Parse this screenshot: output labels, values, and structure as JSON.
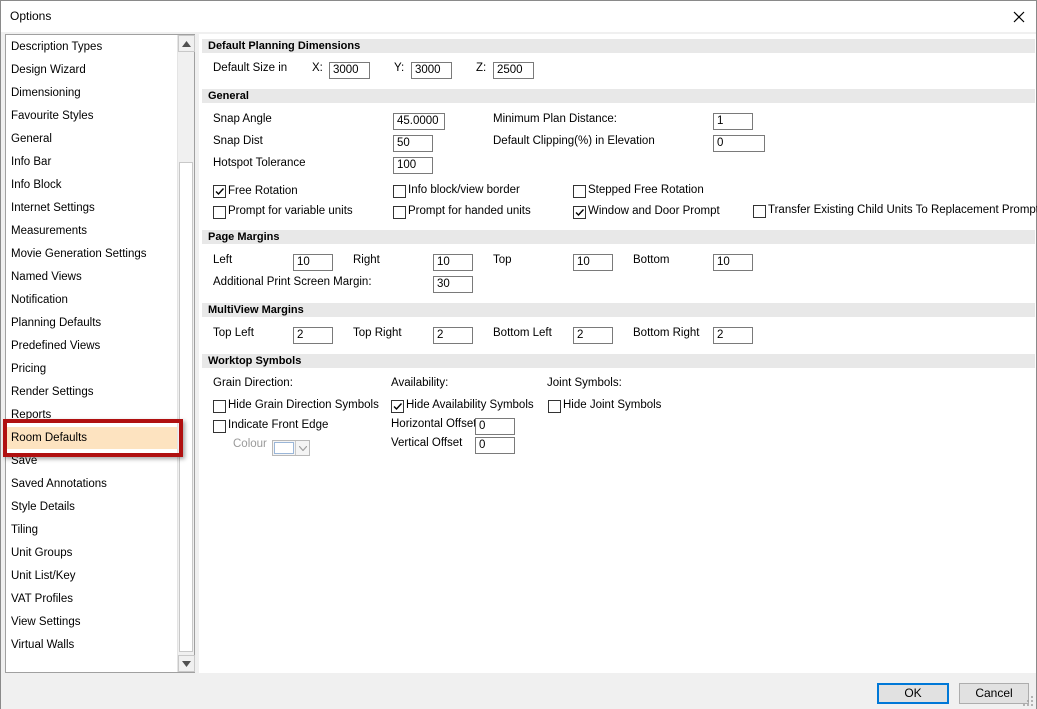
{
  "window": {
    "title": "Options",
    "close_icon": "close-icon"
  },
  "sidebar": {
    "items": [
      "Description Types",
      "Design Wizard",
      "Dimensioning",
      "Favourite Styles",
      "General",
      "Info Bar",
      "Info Block",
      "Internet Settings",
      "Measurements",
      "Movie Generation Settings",
      "Named Views",
      "Notification",
      "Planning Defaults",
      "Predefined Views",
      "Pricing",
      "Render Settings",
      "Reports",
      "Room Defaults",
      "Save",
      "Saved Annotations",
      "Style Details",
      "Tiling",
      "Unit Groups",
      "Unit List/Key",
      "VAT Profiles",
      "View Settings",
      "Virtual Walls"
    ],
    "selected": "Room Defaults",
    "highlight_color": "#b01010",
    "selected_color": "#fde3c0"
  },
  "planning_dimensions": {
    "header": "Default Planning Dimensions",
    "size_label": "Default Size in",
    "x_label": "X:",
    "x_value": "3000",
    "y_label": "Y:",
    "y_value": "3000",
    "z_label": "Z:",
    "z_value": "2500"
  },
  "general": {
    "header": "General",
    "snap_angle_label": "Snap Angle",
    "snap_angle_value": "45.0000",
    "snap_dist_label": "Snap Dist",
    "snap_dist_value": "50",
    "hotspot_label": "Hotspot Tolerance",
    "hotspot_value": "100",
    "min_plan_label": "Minimum Plan Distance:",
    "min_plan_value": "1",
    "clipping_label": "Default Clipping(%) in Elevation",
    "clipping_value": "0",
    "free_rotation": {
      "label": "Free Rotation",
      "checked": true
    },
    "info_block_border": {
      "label": "Info block/view border",
      "checked": false
    },
    "stepped_rotation": {
      "label": "Stepped Free Rotation",
      "checked": false
    },
    "prompt_variable": {
      "label": "Prompt for variable units",
      "checked": false
    },
    "prompt_handed": {
      "label": "Prompt for handed units",
      "checked": false
    },
    "window_door_prompt": {
      "label": "Window and Door Prompt",
      "checked": true
    },
    "transfer_child": {
      "label": "Transfer Existing Child Units To Replacement Prompt",
      "checked": false
    }
  },
  "page_margins": {
    "header": "Page Margins",
    "left_label": "Left",
    "left_value": "10",
    "right_label": "Right",
    "right_value": "10",
    "top_label": "Top",
    "top_value": "10",
    "bottom_label": "Bottom",
    "bottom_value": "10",
    "additional_label": "Additional Print Screen Margin:",
    "additional_value": "30"
  },
  "multiview_margins": {
    "header": "MultiView Margins",
    "top_left_label": "Top Left",
    "top_left_value": "2",
    "top_right_label": "Top Right",
    "top_right_value": "2",
    "bottom_left_label": "Bottom Left",
    "bottom_left_value": "2",
    "bottom_right_label": "Bottom Right",
    "bottom_right_value": "2"
  },
  "worktop_symbols": {
    "header": "Worktop Symbols",
    "grain_label": "Grain Direction:",
    "availability_label": "Availability:",
    "joint_label": "Joint Symbols:",
    "hide_grain": {
      "label": "Hide Grain Direction Symbols",
      "checked": false
    },
    "indicate_front": {
      "label": "Indicate Front Edge",
      "checked": false
    },
    "colour_label": "Colour",
    "hide_availability": {
      "label": "Hide Availability Symbols",
      "checked": true
    },
    "h_offset_label": "Horizontal Offset",
    "h_offset_value": "0",
    "v_offset_label": "Vertical Offset",
    "v_offset_value": "0",
    "hide_joint": {
      "label": "Hide Joint Symbols",
      "checked": false
    }
  },
  "footer": {
    "ok_label": "OK",
    "cancel_label": "Cancel",
    "accent": "#0078d7"
  }
}
